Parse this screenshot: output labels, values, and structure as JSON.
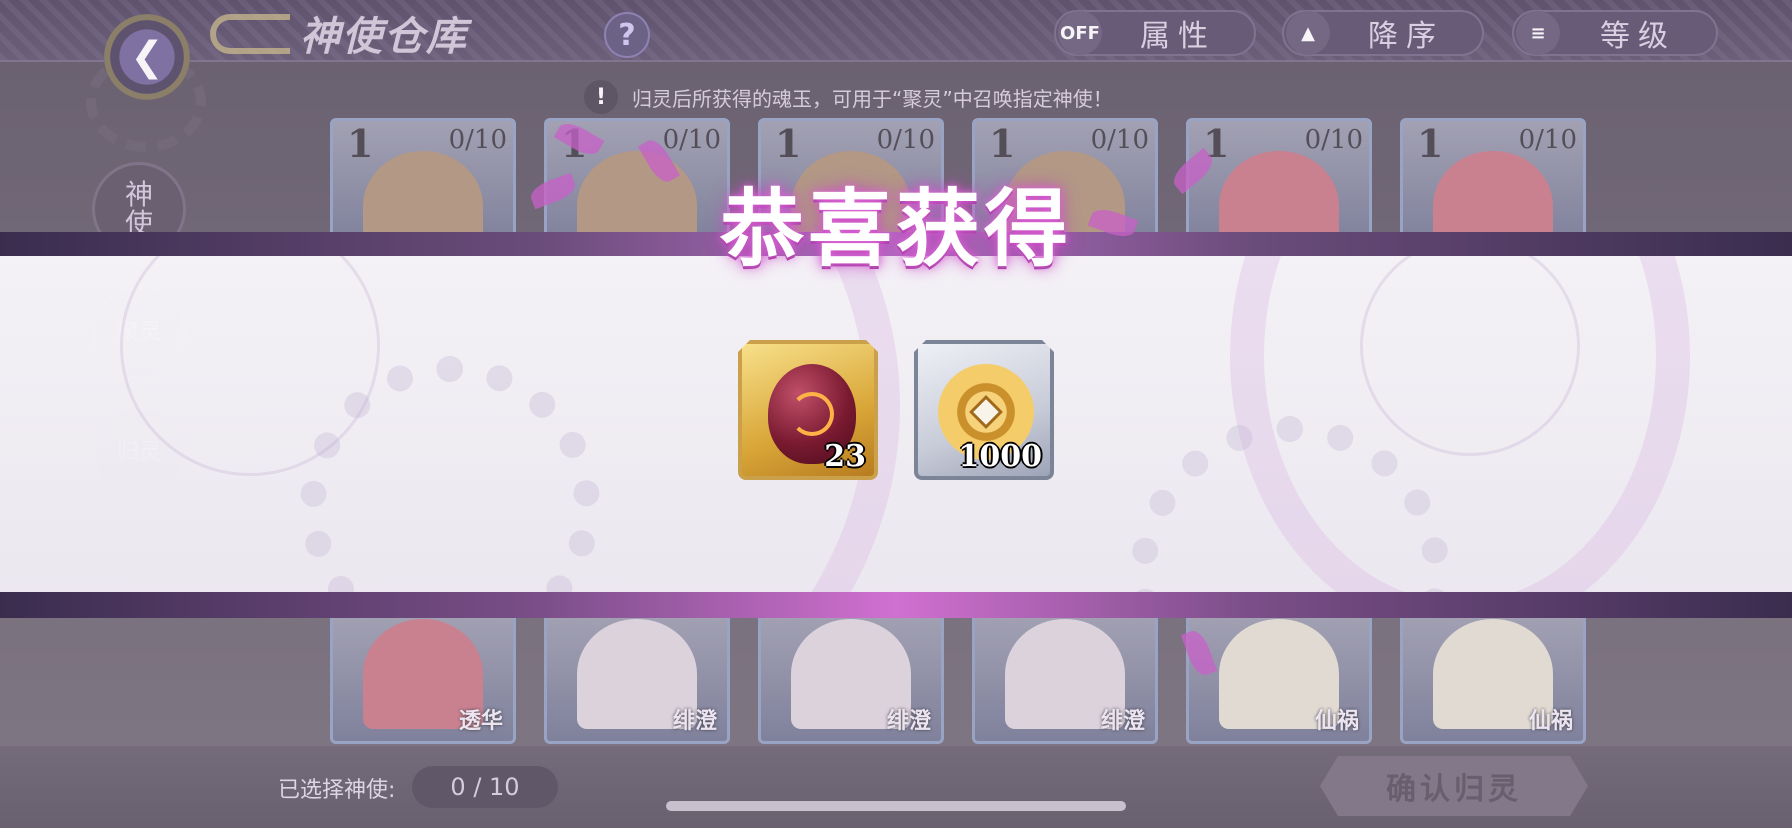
{
  "header": {
    "title": "神使仓库",
    "help_label": "?",
    "filters": [
      {
        "icon": "OFF",
        "label": "属性"
      },
      {
        "icon": "sort-updown-icon",
        "label": "降序"
      },
      {
        "icon": "list-icon",
        "label": "等级"
      }
    ]
  },
  "notice": {
    "icon_text": "!",
    "text": "归灵后所获得的魂玉，可用于“聚灵”中召唤指定神使！"
  },
  "side_tabs": [
    {
      "label": "神\n使"
    },
    {
      "label": "聚灵"
    },
    {
      "label": "归灵"
    }
  ],
  "cards_top": [
    {
      "level": "1",
      "count": "0/10",
      "hair": "#a08060"
    },
    {
      "level": "1",
      "count": "0/10",
      "hair": "#a08060"
    },
    {
      "level": "1",
      "count": "0/10",
      "hair": "#a08060"
    },
    {
      "level": "1",
      "count": "0/10",
      "hair": "#a08060"
    },
    {
      "level": "1",
      "count": "0/10",
      "hair": "#c06070"
    },
    {
      "level": "1",
      "count": "0/10",
      "hair": "#c06070"
    }
  ],
  "cards_bottom": [
    {
      "name": "透华",
      "hair": "#c06070"
    },
    {
      "name": "绯澄",
      "hair": "#d8d0d8"
    },
    {
      "name": "绯澄",
      "hair": "#d8d0d8"
    },
    {
      "name": "绯澄",
      "hair": "#d8d0d8"
    },
    {
      "name": "仙祸",
      "hair": "#e0dccc"
    },
    {
      "name": "仙祸",
      "hair": "#e0dccc"
    }
  ],
  "footer": {
    "selected_label": "已选择神使:",
    "selected_count": "0 / 10",
    "confirm_label": "确认归灵"
  },
  "reward": {
    "title": "恭喜获得",
    "items": [
      {
        "name": "soul-jade",
        "quantity": "23",
        "frame": "gold"
      },
      {
        "name": "coin",
        "quantity": "1000",
        "frame": "silver"
      }
    ]
  },
  "colors": {
    "accent_pink": "#c860c8",
    "gold_frame": "#caa14a",
    "silver_frame": "#7c8498"
  }
}
